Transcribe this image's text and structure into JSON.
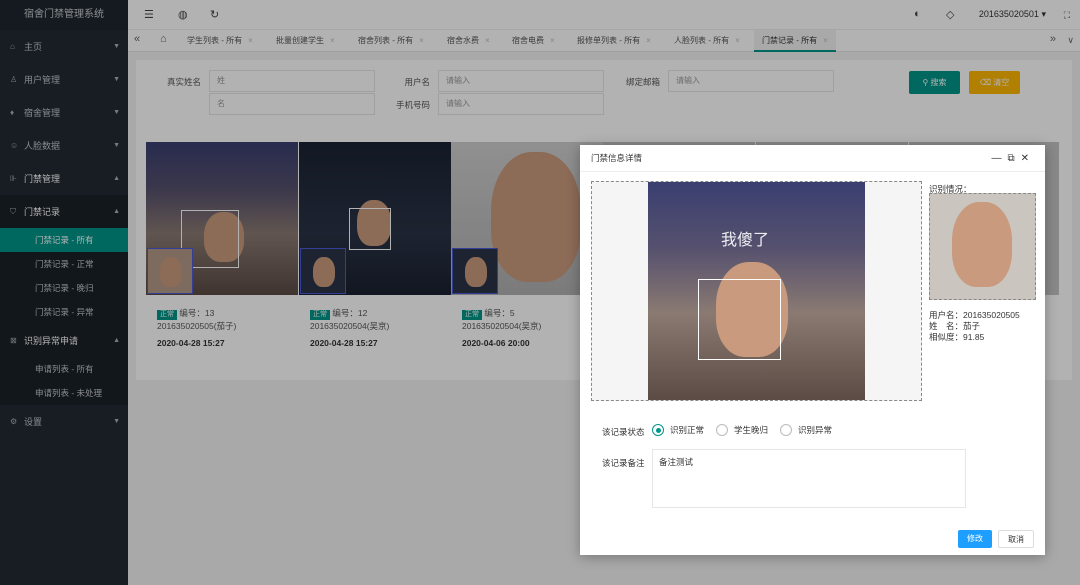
{
  "sidebar": {
    "brand": "宿舍门禁管理系统",
    "items": [
      {
        "label": "主页",
        "icon": "home-icon"
      },
      {
        "label": "用户管理",
        "icon": "user-icon"
      },
      {
        "label": "宿舍管理",
        "icon": "building-icon"
      },
      {
        "label": "人脸数据",
        "icon": "face-icon"
      },
      {
        "label": "门禁管理",
        "icon": "door-icon"
      },
      {
        "label": "门禁记录",
        "icon": "shield-icon"
      },
      {
        "label": "识别异常申请",
        "icon": "apply-icon"
      },
      {
        "label": "设置",
        "icon": "gear-icon"
      }
    ],
    "records_sub": [
      "门禁记录 - 所有",
      "门禁记录 - 正常",
      "门禁记录 - 晚归",
      "门禁记录 - 异常"
    ],
    "apply_sub": [
      "申请列表 - 所有",
      "申请列表 - 未处理"
    ]
  },
  "topbar": {
    "username": "201635020501"
  },
  "tabs": [
    "学生列表 - 所有",
    "批量创建学生",
    "宿舍列表 - 所有",
    "宿舍水费",
    "宿舍电费",
    "报修单列表 - 所有",
    "人脸列表 - 所有",
    "门禁记录 - 所有"
  ],
  "search": {
    "realname_label": "真实姓名",
    "realname_surname_placeholder": "姓",
    "realname_given_placeholder": "名",
    "username_label": "用户名",
    "username_placeholder": "请输入",
    "phone_label": "手机号码",
    "phone_placeholder": "请输入",
    "email_label": "绑定邮箱",
    "email_placeholder": "请输入",
    "search_button": "搜索",
    "clear_button": "清空"
  },
  "cards": [
    {
      "status": "正常",
      "number": "编号：13",
      "user": "201635020505(茄子)",
      "date": "2020-04-28 15:27"
    },
    {
      "status": "正常",
      "number": "编号：12",
      "user": "201635020504(吴京)",
      "date": "2020-04-28 15:27"
    },
    {
      "status": "正常",
      "number": "编号：5",
      "user": "201635020504(吴京)",
      "date": "2020-04-06 20:00"
    }
  ],
  "modal": {
    "title": "门禁信息详情",
    "caption": "我傻了",
    "result_label": "识别情况：",
    "username_line": "用户名：201635020505",
    "name_line": "姓　名：茄子",
    "similarity_line": "相似度：91.85",
    "status_label": "该记录状态",
    "options": [
      "识别正常",
      "学生晚归",
      "识别异常"
    ],
    "selected_option": "识别正常",
    "remark_label": "该记录备注",
    "remark_value": "备注测试",
    "modify_button": "修改",
    "cancel_button": "取消"
  },
  "colors": {
    "accent": "#009688",
    "warning": "#ffb800",
    "sidebar": "#222a33",
    "primary_btn": "#1e9fff"
  }
}
